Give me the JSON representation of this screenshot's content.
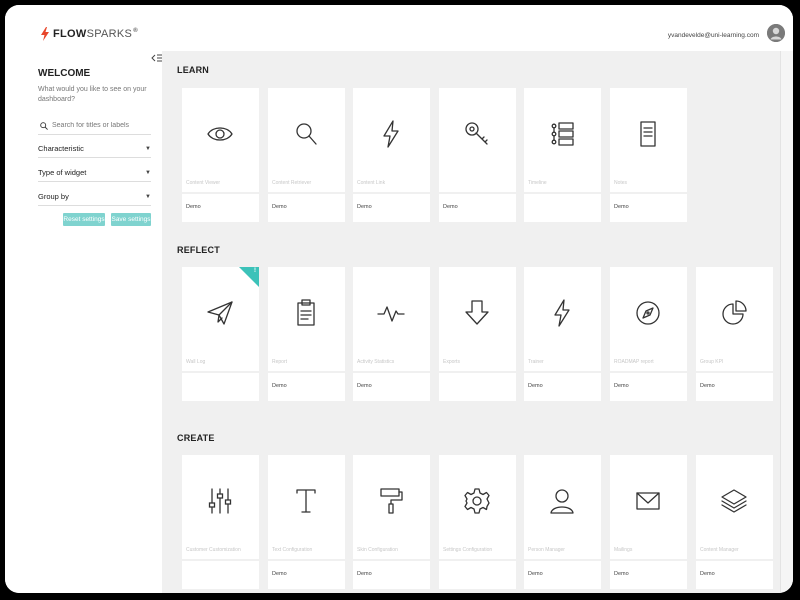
{
  "header": {
    "logo_bold": "FLOW",
    "logo_light": "SPARKS",
    "logo_mark": "®",
    "user_email": "yvandevelde@uni-learning.com"
  },
  "sidebar": {
    "welcome_title": "WELCOME",
    "welcome_subtitle": "What would you like to see on your dashboard?",
    "search_placeholder": "Search for titles or labels",
    "filters": [
      {
        "label": "Characteristic"
      },
      {
        "label": "Type of widget"
      },
      {
        "label": "Group by"
      }
    ],
    "reset_label": "Reset settings",
    "save_label": "Save settings"
  },
  "sections": [
    {
      "title": "LEARN",
      "cards": [
        {
          "name": "Content Viewer",
          "tag": "Demo",
          "icon": "eye-icon"
        },
        {
          "name": "Content Retriever",
          "tag": "Demo",
          "icon": "magnifier-icon"
        },
        {
          "name": "Content Link",
          "tag": "Demo",
          "icon": "lightning-icon"
        },
        {
          "name": "",
          "tag": "Demo",
          "icon": "key-icon"
        },
        {
          "name": "Timeline",
          "tag": "",
          "icon": "timeline-icon"
        },
        {
          "name": "Notes",
          "tag": "Demo",
          "icon": "notes-icon"
        }
      ]
    },
    {
      "title": "REFLECT",
      "cards": [
        {
          "name": "Wall Log",
          "tag": "",
          "icon": "paper-plane-icon",
          "badge": "!"
        },
        {
          "name": "Report",
          "tag": "Demo",
          "icon": "clipboard-icon"
        },
        {
          "name": "Activity Statistics",
          "tag": "Demo",
          "icon": "pulse-icon"
        },
        {
          "name": "Exports",
          "tag": "",
          "icon": "arrow-down-icon"
        },
        {
          "name": "Trainer",
          "tag": "Demo",
          "icon": "lightning-icon"
        },
        {
          "name": "ROADMAP report",
          "tag": "Demo",
          "icon": "compass-icon"
        },
        {
          "name": "Group KPI",
          "tag": "Demo",
          "icon": "pie-chart-icon"
        }
      ]
    },
    {
      "title": "CREATE",
      "cards": [
        {
          "name": "Customer Customization",
          "tag": "",
          "icon": "sliders-icon"
        },
        {
          "name": "Text Configuration",
          "tag": "Demo",
          "icon": "text-icon"
        },
        {
          "name": "Skin Configuration",
          "tag": "Demo",
          "icon": "paint-roller-icon"
        },
        {
          "name": "Settings Configuration",
          "tag": "",
          "icon": "gear-icon"
        },
        {
          "name": "Person Manager",
          "tag": "Demo",
          "icon": "person-icon"
        },
        {
          "name": "Mailings",
          "tag": "Demo",
          "icon": "envelope-icon"
        },
        {
          "name": "Content Manager",
          "tag": "Demo",
          "icon": "layers-icon"
        }
      ]
    }
  ],
  "colors": {
    "accent": "#3cc2b9",
    "button": "#7fd3cf",
    "logo_bolt": "#e8462b",
    "main_bg": "#f0f0f0"
  }
}
